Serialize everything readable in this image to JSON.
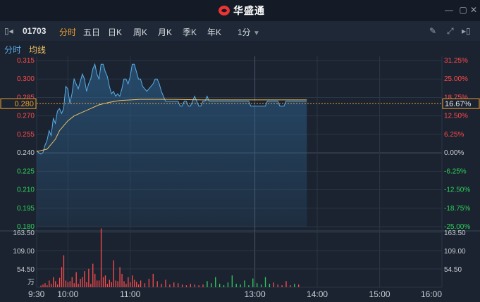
{
  "app": {
    "title": "华盛通"
  },
  "toolbar": {
    "code": "01703",
    "tabs": [
      {
        "label": "分时",
        "active": true
      },
      {
        "label": "五日",
        "active": false
      },
      {
        "label": "日K",
        "active": false
      },
      {
        "label": "周K",
        "active": false
      },
      {
        "label": "月K",
        "active": false
      },
      {
        "label": "季K",
        "active": false
      },
      {
        "label": "年K",
        "active": false
      }
    ],
    "interval": "1分"
  },
  "legend": {
    "timeshare": "分时",
    "average": "均线"
  },
  "colors": {
    "up": "#ff4a4a",
    "down": "#2fd15a",
    "price": "#5aaee8",
    "avg": "#f0c060",
    "accent": "#f0a030"
  },
  "chart_data": {
    "type": "line",
    "price_ticks": [
      "0.315",
      "0.300",
      "0.285",
      "0.270",
      "0.255",
      "0.240",
      "0.225",
      "0.210",
      "0.195",
      "0.180"
    ],
    "pct_ticks": [
      "31.25%",
      "25.00%",
      "18.75%",
      "12.50%",
      "6.25%",
      "0.00%",
      "-6.25%",
      "-12.50%",
      "-18.75%",
      "-25.00%"
    ],
    "ylim": [
      0.18,
      0.315
    ],
    "prev_close": 0.24,
    "current_price": "0.280",
    "current_pct": "16.67%",
    "time_labels": [
      "9:30",
      "10:00",
      "11:00",
      "13:00",
      "14:00",
      "15:00",
      "16:00"
    ],
    "volume_ticks": [
      "163.50",
      "109.00",
      "54.50"
    ],
    "volume_unit": "万",
    "price_series": [
      [
        0,
        0.242
      ],
      [
        2,
        0.24
      ],
      [
        4,
        0.239
      ],
      [
        6,
        0.24
      ],
      [
        8,
        0.246
      ],
      [
        10,
        0.25
      ],
      [
        12,
        0.258
      ],
      [
        14,
        0.254
      ],
      [
        16,
        0.268
      ],
      [
        18,
        0.264
      ],
      [
        20,
        0.274
      ],
      [
        22,
        0.276
      ],
      [
        24,
        0.272
      ],
      [
        26,
        0.276
      ],
      [
        28,
        0.294
      ],
      [
        30,
        0.292
      ],
      [
        32,
        0.28
      ],
      [
        34,
        0.288
      ],
      [
        36,
        0.3
      ],
      [
        38,
        0.296
      ],
      [
        40,
        0.292
      ],
      [
        42,
        0.298
      ],
      [
        44,
        0.304
      ],
      [
        46,
        0.3
      ],
      [
        48,
        0.29
      ],
      [
        50,
        0.296
      ],
      [
        52,
        0.3
      ],
      [
        54,
        0.308
      ],
      [
        56,
        0.312
      ],
      [
        58,
        0.304
      ],
      [
        60,
        0.3
      ],
      [
        62,
        0.312
      ],
      [
        64,
        0.312
      ],
      [
        66,
        0.306
      ],
      [
        68,
        0.302
      ],
      [
        70,
        0.294
      ],
      [
        72,
        0.288
      ],
      [
        74,
        0.29
      ],
      [
        76,
        0.286
      ],
      [
        78,
        0.288
      ],
      [
        80,
        0.286
      ],
      [
        82,
        0.292
      ],
      [
        84,
        0.3
      ],
      [
        86,
        0.3
      ],
      [
        88,
        0.296
      ],
      [
        90,
        0.302
      ],
      [
        92,
        0.312
      ],
      [
        94,
        0.312
      ],
      [
        96,
        0.306
      ],
      [
        98,
        0.3
      ],
      [
        100,
        0.3
      ],
      [
        102,
        0.294
      ],
      [
        104,
        0.292
      ],
      [
        106,
        0.29
      ],
      [
        108,
        0.292
      ],
      [
        110,
        0.294
      ],
      [
        112,
        0.296
      ],
      [
        114,
        0.3
      ],
      [
        116,
        0.3
      ],
      [
        118,
        0.296
      ],
      [
        120,
        0.29
      ],
      [
        122,
        0.286
      ],
      [
        124,
        0.282
      ],
      [
        126,
        0.282
      ],
      [
        128,
        0.282
      ],
      [
        130,
        0.282
      ],
      [
        132,
        0.282
      ],
      [
        134,
        0.282
      ],
      [
        136,
        0.282
      ],
      [
        138,
        0.278
      ],
      [
        140,
        0.278
      ],
      [
        142,
        0.282
      ],
      [
        144,
        0.282
      ],
      [
        146,
        0.278
      ],
      [
        148,
        0.278
      ],
      [
        150,
        0.282
      ],
      [
        152,
        0.286
      ],
      [
        154,
        0.282
      ],
      [
        156,
        0.278
      ],
      [
        158,
        0.278
      ],
      [
        160,
        0.282
      ],
      [
        162,
        0.282
      ],
      [
        164,
        0.286
      ],
      [
        166,
        0.282
      ],
      [
        168,
        0.282
      ],
      [
        170,
        0.282
      ],
      [
        172,
        0.282
      ],
      [
        174,
        0.282
      ],
      [
        176,
        0.282
      ],
      [
        178,
        0.282
      ],
      [
        180,
        0.282
      ],
      [
        182,
        0.282
      ],
      [
        184,
        0.282
      ],
      [
        186,
        0.282
      ],
      [
        188,
        0.282
      ],
      [
        190,
        0.282
      ],
      [
        192,
        0.282
      ],
      [
        194,
        0.282
      ],
      [
        196,
        0.282
      ],
      [
        198,
        0.282
      ],
      [
        200,
        0.282
      ],
      [
        202,
        0.282
      ],
      [
        204,
        0.282
      ],
      [
        206,
        0.278
      ],
      [
        208,
        0.278
      ],
      [
        210,
        0.278
      ],
      [
        212,
        0.278
      ],
      [
        214,
        0.278
      ],
      [
        216,
        0.278
      ],
      [
        218,
        0.278
      ],
      [
        220,
        0.278
      ],
      [
        222,
        0.282
      ],
      [
        224,
        0.282
      ],
      [
        226,
        0.282
      ],
      [
        228,
        0.282
      ],
      [
        230,
        0.282
      ],
      [
        232,
        0.282
      ],
      [
        234,
        0.278
      ],
      [
        236,
        0.278
      ],
      [
        238,
        0.278
      ],
      [
        240,
        0.282
      ],
      [
        242,
        0.282
      ],
      [
        244,
        0.282
      ],
      [
        246,
        0.282
      ],
      [
        248,
        0.282
      ],
      [
        250,
        0.282
      ],
      [
        252,
        0.282
      ],
      [
        254,
        0.282
      ],
      [
        256,
        0.282
      ],
      [
        258,
        0.282
      ],
      [
        260,
        0.282
      ]
    ],
    "avg_series": [
      [
        0,
        0.241
      ],
      [
        10,
        0.243
      ],
      [
        18,
        0.251
      ],
      [
        22,
        0.258
      ],
      [
        26,
        0.262
      ],
      [
        30,
        0.266
      ],
      [
        36,
        0.27
      ],
      [
        44,
        0.273
      ],
      [
        52,
        0.276
      ],
      [
        60,
        0.279
      ],
      [
        70,
        0.281
      ],
      [
        80,
        0.2825
      ],
      [
        100,
        0.2835
      ],
      [
        130,
        0.2835
      ],
      [
        160,
        0.283
      ],
      [
        200,
        0.283
      ],
      [
        260,
        0.283
      ]
    ],
    "volumes": [
      [
        4,
        5,
        1
      ],
      [
        6,
        8,
        1
      ],
      [
        8,
        12,
        1
      ],
      [
        10,
        6,
        1
      ],
      [
        12,
        20,
        1
      ],
      [
        14,
        10,
        1
      ],
      [
        16,
        30,
        1
      ],
      [
        18,
        18,
        1
      ],
      [
        20,
        8,
        1
      ],
      [
        22,
        28,
        1
      ],
      [
        24,
        60,
        1
      ],
      [
        26,
        95,
        1
      ],
      [
        28,
        20,
        1
      ],
      [
        30,
        15,
        1
      ],
      [
        32,
        18,
        1
      ],
      [
        34,
        30,
        1
      ],
      [
        36,
        12,
        1
      ],
      [
        38,
        45,
        1
      ],
      [
        40,
        10,
        1
      ],
      [
        42,
        25,
        1
      ],
      [
        44,
        30,
        1
      ],
      [
        46,
        48,
        1
      ],
      [
        48,
        15,
        1
      ],
      [
        50,
        55,
        1
      ],
      [
        52,
        10,
        1
      ],
      [
        54,
        70,
        1
      ],
      [
        56,
        40,
        1
      ],
      [
        58,
        20,
        1
      ],
      [
        60,
        20,
        1
      ],
      [
        62,
        175,
        1
      ],
      [
        64,
        30,
        1
      ],
      [
        66,
        35,
        1
      ],
      [
        68,
        10,
        1
      ],
      [
        70,
        22,
        1
      ],
      [
        72,
        15,
        1
      ],
      [
        74,
        80,
        1
      ],
      [
        76,
        20,
        1
      ],
      [
        78,
        18,
        1
      ],
      [
        80,
        60,
        1
      ],
      [
        82,
        40,
        1
      ],
      [
        84,
        18,
        1
      ],
      [
        86,
        10,
        1
      ],
      [
        88,
        30,
        1
      ],
      [
        90,
        15,
        1
      ],
      [
        92,
        35,
        1
      ],
      [
        94,
        22,
        1
      ],
      [
        96,
        16,
        1
      ],
      [
        98,
        8,
        1
      ],
      [
        100,
        20,
        1
      ],
      [
        104,
        12,
        1
      ],
      [
        108,
        25,
        1
      ],
      [
        112,
        40,
        1
      ],
      [
        116,
        18,
        1
      ],
      [
        120,
        10,
        1
      ],
      [
        124,
        22,
        1
      ],
      [
        128,
        8,
        1
      ],
      [
        132,
        14,
        1
      ],
      [
        136,
        12,
        1
      ],
      [
        140,
        8,
        1
      ],
      [
        144,
        6,
        1
      ],
      [
        148,
        10,
        1
      ],
      [
        152,
        8,
        1
      ],
      [
        156,
        6,
        1
      ],
      [
        160,
        8,
        1
      ],
      [
        164,
        18,
        0
      ],
      [
        168,
        12,
        0
      ],
      [
        172,
        30,
        0
      ],
      [
        176,
        10,
        0
      ],
      [
        180,
        6,
        0
      ],
      [
        184,
        14,
        0
      ],
      [
        188,
        35,
        0
      ],
      [
        192,
        10,
        0
      ],
      [
        196,
        8,
        0
      ],
      [
        200,
        20,
        0
      ],
      [
        204,
        6,
        0
      ],
      [
        208,
        26,
        0
      ],
      [
        212,
        12,
        0
      ],
      [
        216,
        8,
        0
      ],
      [
        220,
        30,
        0
      ],
      [
        224,
        10,
        0
      ],
      [
        228,
        14,
        1
      ],
      [
        232,
        8,
        1
      ],
      [
        236,
        6,
        1
      ],
      [
        240,
        18,
        1
      ],
      [
        244,
        6,
        1
      ],
      [
        248,
        10,
        0
      ],
      [
        252,
        8,
        1
      ]
    ]
  }
}
